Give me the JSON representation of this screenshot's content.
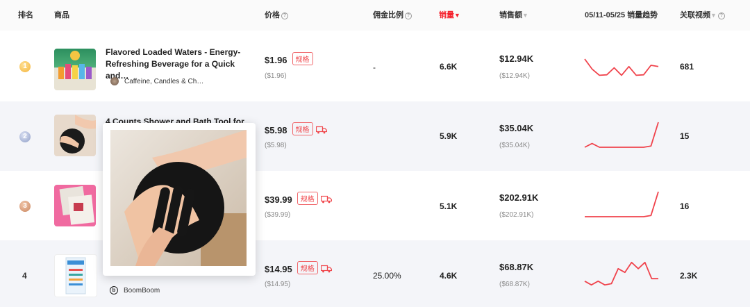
{
  "header": {
    "rank": "排名",
    "product": "商品",
    "price": "价格",
    "commission": "佣金比例",
    "sales": "销量",
    "sales_arrow": "▼",
    "revenue": "销售额",
    "revenue_arrow": "▼",
    "trend": "05/11-05/25 销量趋势",
    "videos": "关联视频",
    "videos_arrow": "▼",
    "help": "?"
  },
  "spec_label": "规格",
  "rows": [
    {
      "rank": "1",
      "rank_style": "gold",
      "name": "Flavored Loaded Waters - Energy-Refreshing Beverage for a Quick and…",
      "shop": "Caffeine, Candles & Ch…",
      "price": "$1.96",
      "price_sub": "($1.96)",
      "has_truck": false,
      "commission": "-",
      "sales": "6.6K",
      "revenue": "$12.94K",
      "revenue_sub": "($12.94K)",
      "trend": [
        0.75,
        0.35,
        0.1,
        0.12,
        0.4,
        0.1,
        0.45,
        0.1,
        0.12,
        0.5,
        0.45
      ],
      "videos": "681",
      "thumb_icon": "drinks-product-icon"
    },
    {
      "rank": "2",
      "rank_style": "silver",
      "name": "4 Counts Shower and Bath Tool for",
      "shop": "",
      "price": "$5.98",
      "price_sub": "($5.98)",
      "has_truck": true,
      "commission": "",
      "sales": "5.9K",
      "revenue": "$35.04K",
      "revenue_sub": "($35.04K)",
      "trend": [
        0.0,
        0.15,
        0.0,
        0.0,
        0.0,
        0.0,
        0.0,
        0.0,
        0.0,
        0.05,
        1.0
      ],
      "videos": "15",
      "thumb_icon": "bath-mitt-product-icon"
    },
    {
      "rank": "3",
      "rank_style": "bronze",
      "name": "",
      "shop": "",
      "price": "$39.99",
      "price_sub": "($39.99)",
      "has_truck": true,
      "commission": "",
      "sales": "5.1K",
      "revenue": "$202.91K",
      "revenue_sub": "($202.91K)",
      "trend": [
        0.0,
        0.0,
        0.0,
        0.0,
        0.0,
        0.0,
        0.0,
        0.0,
        0.0,
        0.05,
        1.0
      ],
      "videos": "16",
      "thumb_icon": "box-product-icon"
    },
    {
      "rank": "4",
      "rank_style": "plain",
      "name": "",
      "shop": "BoomBoom",
      "price": "$14.95",
      "price_sub": "($14.95)",
      "has_truck": true,
      "commission": "25.00%",
      "sales": "4.6K",
      "revenue": "$68.87K",
      "revenue_sub": "($68.87K)",
      "trend": [
        0.2,
        0.05,
        0.2,
        0.05,
        0.1,
        0.7,
        0.55,
        0.95,
        0.7,
        0.95,
        0.3,
        0.3
      ],
      "videos": "2.3K",
      "thumb_icon": "pouch-product-icon"
    }
  ],
  "colors": {
    "accent_red": "#f5222d",
    "spark": "#f0434c",
    "alt_row": "#f4f5f9"
  }
}
